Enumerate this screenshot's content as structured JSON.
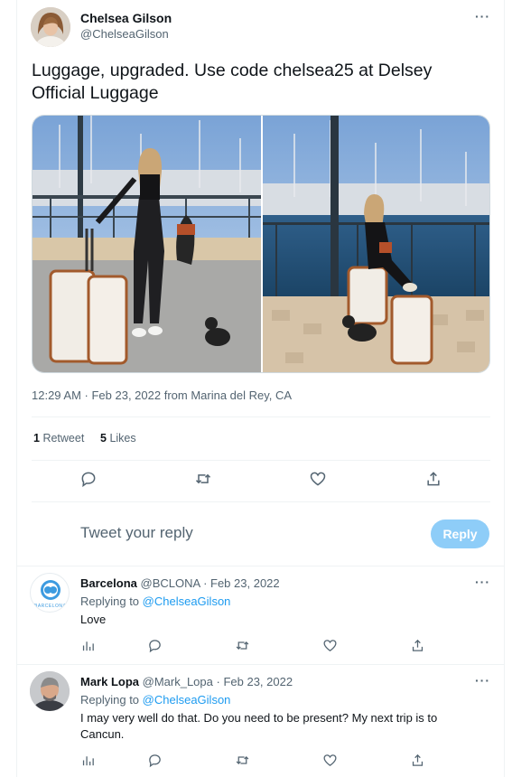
{
  "tweet": {
    "author_name": "Chelsea Gilson",
    "author_handle": "@ChelseaGilson",
    "more_label": "···",
    "text": "Luggage, upgraded. Use code chelsea25 at Delsey Official Luggage",
    "timestamp": "12:29 AM · Feb 23, 2022 from Marina del Rey, CA",
    "retweets_count": "1",
    "retweets_label": "Retweet",
    "likes_count": "5",
    "likes_label": "Likes"
  },
  "composer": {
    "placeholder": "Tweet your reply",
    "reply_button": "Reply"
  },
  "replies": [
    {
      "name": "Barcelona",
      "handle": "@BCLONA",
      "separator": " · ",
      "date": "Feb 23, 2022",
      "replying_prefix": "Replying to ",
      "replying_to": "@ChelseaGilson",
      "text": "Love",
      "more": "···",
      "avatar_text": "BARCELONA"
    },
    {
      "name": "Mark Lopa",
      "handle": "@Mark_Lopa",
      "separator": " · ",
      "date": "Feb 23, 2022",
      "replying_prefix": "Replying to ",
      "replying_to": "@ChelseaGilson",
      "text": "I may very well do that. Do you need to be present? My next trip is to Cancun.",
      "more": "···"
    }
  ],
  "colors": {
    "accent": "#1d9bf0",
    "reply_button_disabled": "#8ecdf8",
    "muted_text": "#536471",
    "divider": "#eff3f4"
  },
  "icons": {
    "action_bar": [
      "reply-icon",
      "retweet-icon",
      "like-icon",
      "share-icon"
    ],
    "reply_action_bar": [
      "analytics-icon",
      "reply-icon",
      "retweet-icon",
      "like-icon",
      "share-icon"
    ]
  }
}
